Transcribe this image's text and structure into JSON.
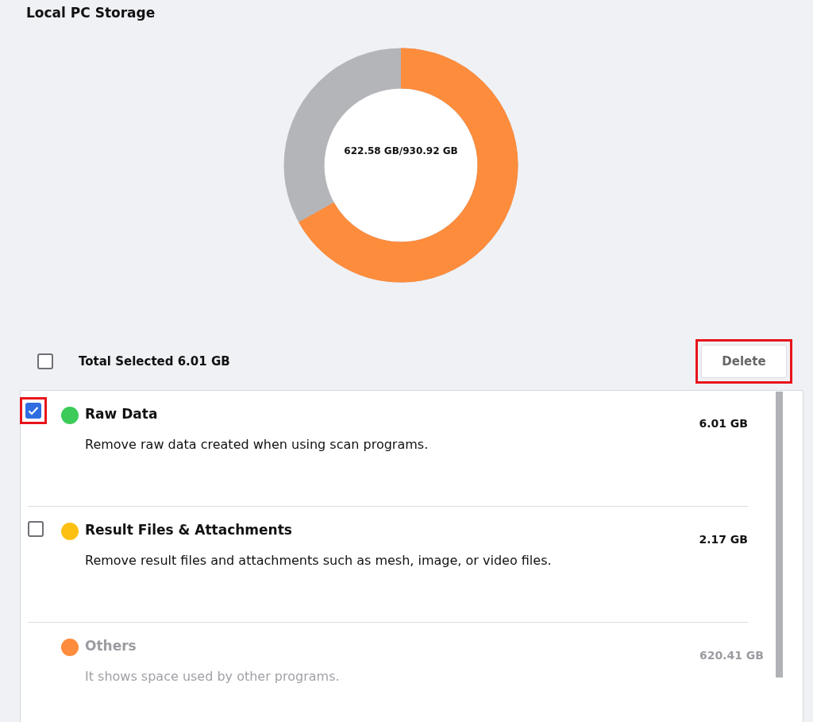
{
  "title": "Local PC Storage",
  "storage": {
    "label": "622.58 GB/930.92 GB",
    "level": 0.669
  },
  "selection": {
    "checked": false,
    "label": "Total Selected 6.01 GB"
  },
  "delete_button": {
    "label": "Delete",
    "highlighted": true
  },
  "items": [
    {
      "title": "Raw Data",
      "description": "Remove raw data created when using scan programs.",
      "size": "6.01 GB",
      "color": "#3ccb59",
      "checked": true,
      "disabled": false,
      "highlighted": true
    },
    {
      "title": "Result Files & Attachments",
      "description": "Remove result files and attachments such as mesh, image, or video files.",
      "size": "2.17 GB",
      "color": "#fcc012",
      "checked": false,
      "disabled": false,
      "highlighted": false
    },
    {
      "title": "Others",
      "description": "It shows space used by other programs.",
      "size": "620.41 GB",
      "color": "#fd8c3c",
      "disabled": true,
      "highlighted": false
    }
  ]
}
